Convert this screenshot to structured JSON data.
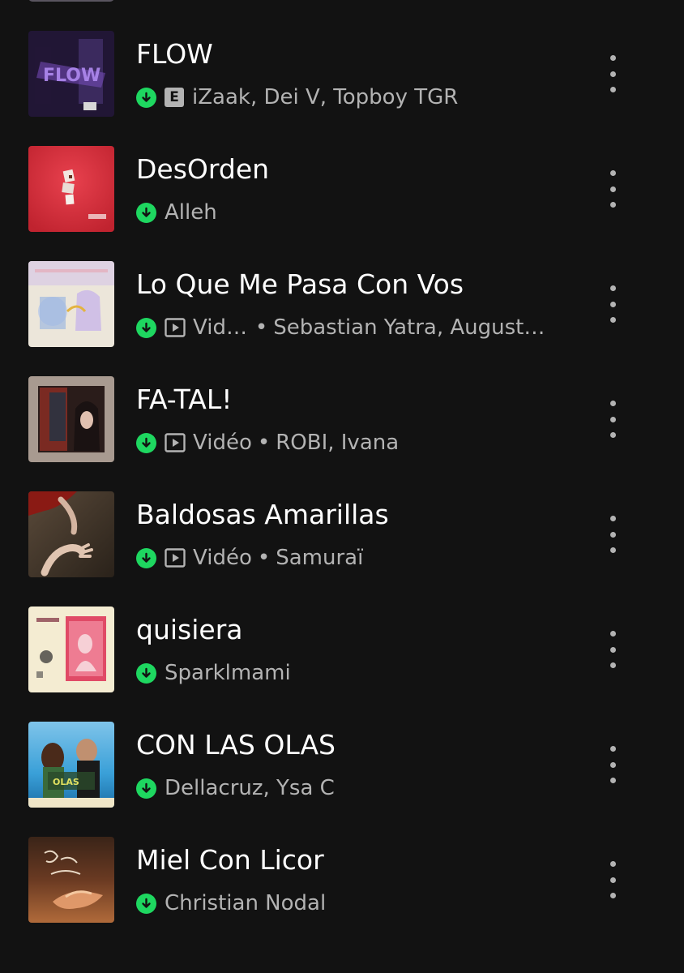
{
  "tracks": [
    {
      "title": "FLOW",
      "explicit": true,
      "video": false,
      "video_label": "",
      "artists": "iZaak, Dei V, Topboy TGR",
      "downloaded": true
    },
    {
      "title": "DesOrden",
      "explicit": false,
      "video": false,
      "video_label": "",
      "artists": "Alleh",
      "downloaded": true
    },
    {
      "title": "Lo Que Me Pasa Con Vos",
      "explicit": false,
      "video": true,
      "video_label": "Vidéo",
      "artists": "Sebastian Yatra, Augusto…",
      "downloaded": true
    },
    {
      "title": "FA-TAL!",
      "explicit": false,
      "video": true,
      "video_label": "Vidéo",
      "artists": "ROBI, Ivana",
      "downloaded": true
    },
    {
      "title": "Baldosas Amarillas",
      "explicit": false,
      "video": true,
      "video_label": "Vidéo",
      "artists": "Samuraï",
      "downloaded": true
    },
    {
      "title": "quisiera",
      "explicit": false,
      "video": false,
      "video_label": "",
      "artists": "Sparklmami",
      "downloaded": true
    },
    {
      "title": "CON LAS OLAS",
      "explicit": false,
      "video": false,
      "video_label": "",
      "artists": "Dellacruz, Ysa C",
      "downloaded": true
    },
    {
      "title": "Miel Con Licor",
      "explicit": false,
      "video": false,
      "video_label": "",
      "artists": "Christian Nodal",
      "downloaded": true
    }
  ],
  "badges": {
    "explicit": "E",
    "separator": "•"
  },
  "icons": {
    "download": "download-icon",
    "explicit": "explicit-icon",
    "video": "video-icon",
    "more": "more-options-icon"
  },
  "colors": {
    "background": "#121212",
    "accent": "#1ed760",
    "title": "#ffffff",
    "subtitle": "#b3b3b3"
  }
}
